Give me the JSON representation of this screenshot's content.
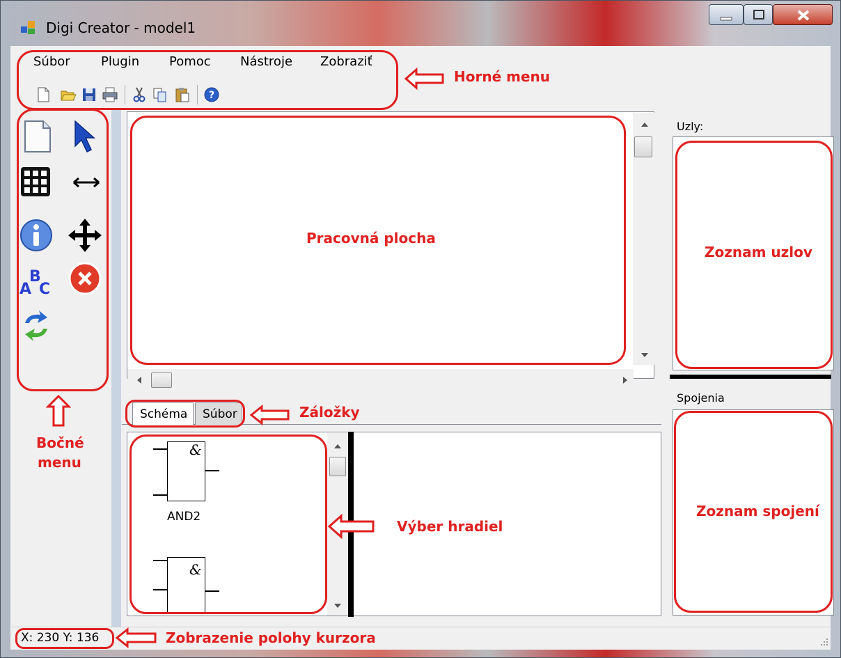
{
  "window": {
    "title": "Digi Creator - model1"
  },
  "menu": {
    "items": [
      {
        "label": "Súbor"
      },
      {
        "label": "Plugin"
      },
      {
        "label": "Pomoc"
      },
      {
        "label": "Nástroje"
      },
      {
        "label": "Zobraziť"
      }
    ]
  },
  "toolbar": [
    "new-file-icon",
    "open-folder-icon",
    "save-icon",
    "print-icon",
    "cut-icon",
    "copy-icon",
    "paste-icon",
    "help-icon"
  ],
  "sidebar_tools": [
    "new-page-icon",
    "pointer-icon",
    "grid-icon",
    "horizontal-resize-icon",
    "info-icon",
    "move-icon",
    "abc-text-icon",
    "delete-icon",
    "refresh-icon"
  ],
  "tabs": [
    {
      "label": "Schéma",
      "active": true
    },
    {
      "label": "Súbor",
      "active": false
    }
  ],
  "gates": [
    {
      "symbol": "&",
      "label": "AND2"
    },
    {
      "symbol": "&",
      "label": ""
    }
  ],
  "right_panel": {
    "nodes_label": "Uzly:",
    "connections_label": "Spojenia"
  },
  "status": {
    "cursor": "X: 230 Y: 136"
  },
  "annotations": {
    "top_menu": "Horné menu",
    "side_menu_line1": "Bočné",
    "side_menu_line2": "menu",
    "workspace": "Pracovná plocha",
    "tabs": "Záložky",
    "gate_selection": "Výber hradiel",
    "node_list": "Zoznam uzlov",
    "connection_list": "Zoznam spojení",
    "cursor_position": "Zobrazenie polohy kurzora"
  },
  "colors": {
    "annotation_red": "#e02020",
    "window_bg": "#f0f0f0"
  }
}
